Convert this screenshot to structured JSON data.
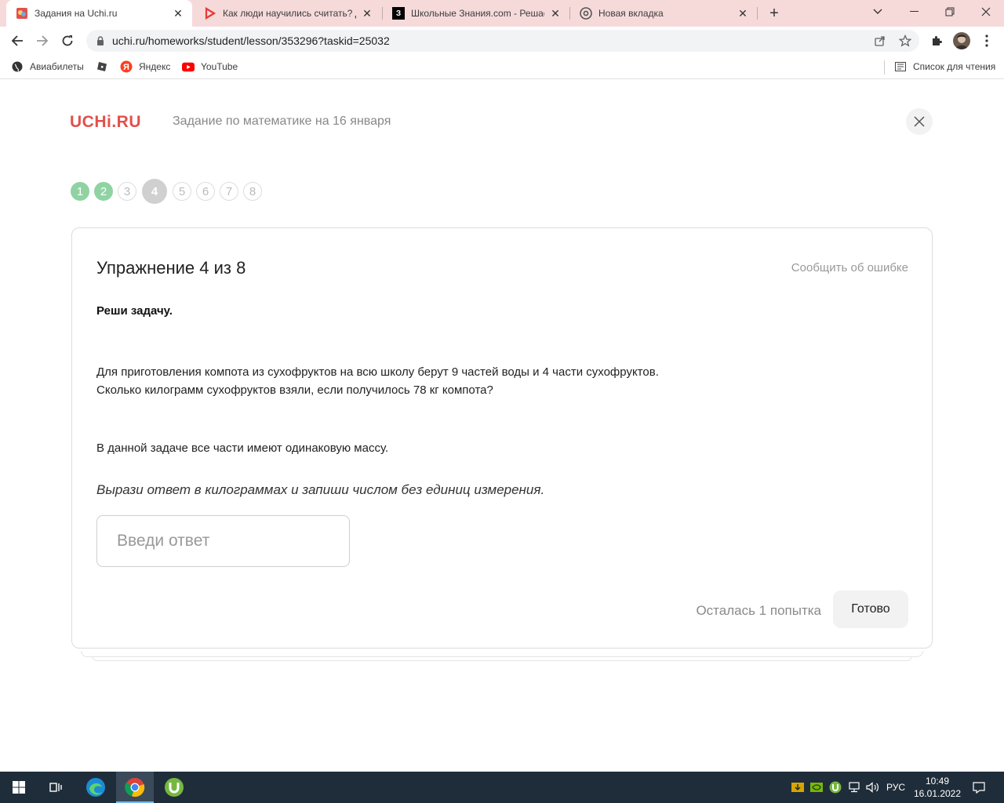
{
  "browser": {
    "tabs": [
      {
        "title": "Задания на Uchi.ru",
        "active": true
      },
      {
        "title": "Как люди научились считать? Д",
        "active": false
      },
      {
        "title": "Школьные Знания.com - Решае",
        "active": false
      },
      {
        "title": "Новая вкладка",
        "active": false
      }
    ],
    "url": "uchi.ru/homeworks/student/lesson/353296?taskid=25032",
    "bookmarks": [
      "Авиабилеты",
      "Яндекс",
      "YouTube"
    ],
    "reading_list": "Список для чтения"
  },
  "page": {
    "logo": "UCHi.RU",
    "subtitle": "Задание по математике на 16 января",
    "steps": [
      {
        "n": "1",
        "state": "done"
      },
      {
        "n": "2",
        "state": "done"
      },
      {
        "n": "3",
        "state": "todo"
      },
      {
        "n": "4",
        "state": "current"
      },
      {
        "n": "5",
        "state": "todo"
      },
      {
        "n": "6",
        "state": "todo"
      },
      {
        "n": "7",
        "state": "todo"
      },
      {
        "n": "8",
        "state": "todo"
      }
    ],
    "exercise_title": "Упражнение 4 из 8",
    "report_link": "Сообщить об ошибке",
    "instruction": "Реши задачу.",
    "problem_line1": "Для приготовления компота из сухофруктов на всю школу берут 9 частей воды и 4 части сухофруктов.",
    "problem_line2": "Сколько килограмм сухофруктов взяли, если получилось 78 кг компота?",
    "note": "В данной задаче все части имеют одинаковую массу.",
    "hint": "Вырази ответ в килограммах и запиши числом без единиц измерения.",
    "answer_placeholder": "Введи ответ",
    "answer_value": "",
    "attempts": "Осталась 1 попытка",
    "submit": "Готово"
  },
  "taskbar": {
    "lang": "РУС",
    "time": "10:49",
    "date": "16.01.2022"
  },
  "colors": {
    "tabstrip": "#f6dada",
    "brand": "#e2504c",
    "step_done": "#8fd3a3",
    "step_current": "#d0d0d0",
    "taskbar": "#1f2d3a"
  }
}
